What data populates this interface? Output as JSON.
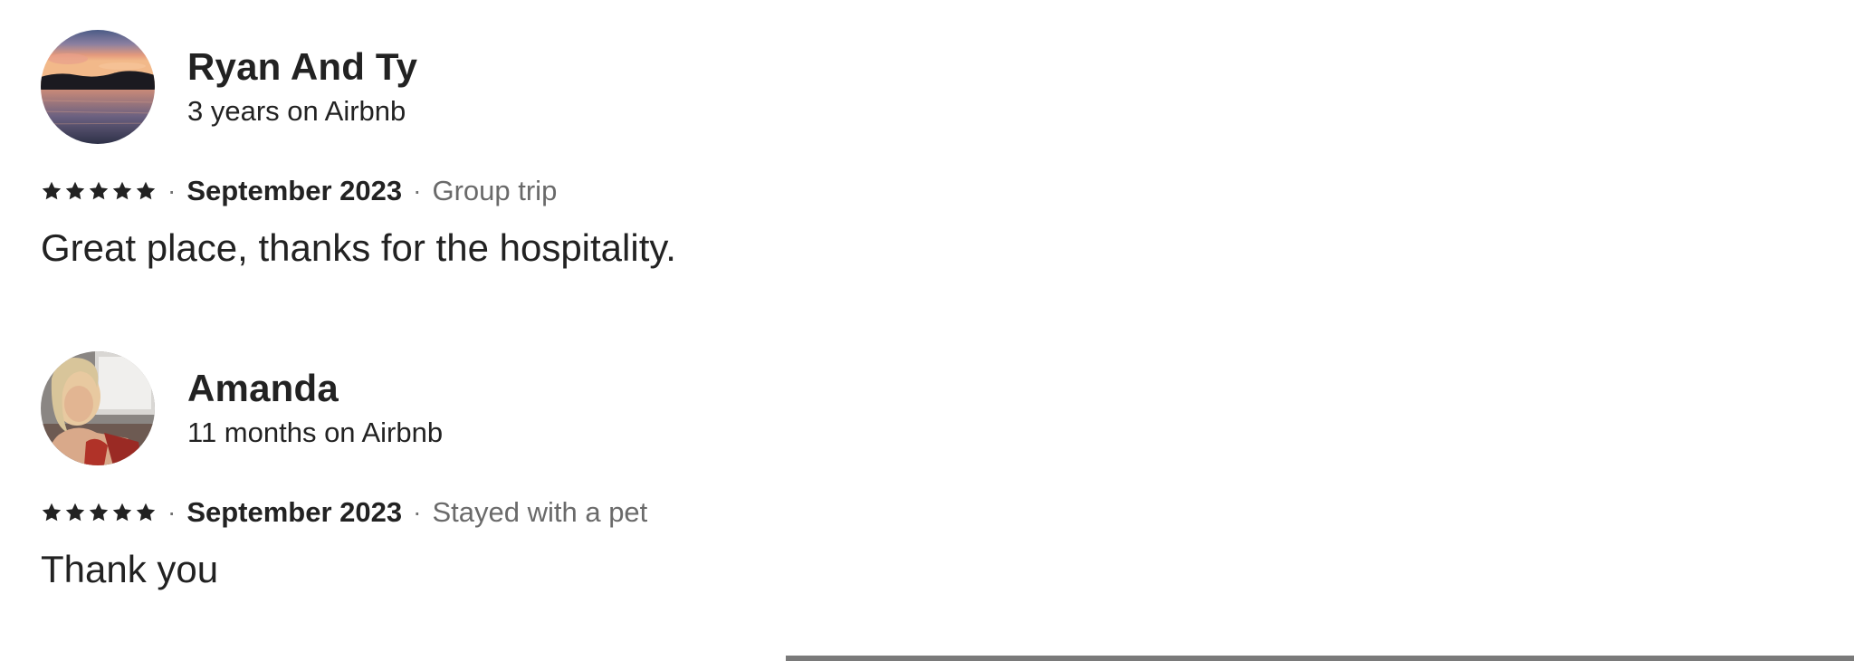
{
  "reviews": [
    {
      "name": "Ryan And Ty",
      "tenure": "3 years on Airbnb",
      "avatar_icon": "sunset-lake-photo",
      "rating": 5,
      "date": "September 2023",
      "trip_type": "Group trip",
      "comment": "Great place, thanks for the hospitality."
    },
    {
      "name": "Amanda",
      "tenure": "11 months on Airbnb",
      "avatar_icon": "profile-photo",
      "rating": 5,
      "date": "September 2023",
      "trip_type": "Stayed with a pet",
      "comment": "Thank you"
    }
  ],
  "separator": "·",
  "colors": {
    "text": "#222222",
    "secondary": "#6a6a6a",
    "star": "#222222"
  }
}
